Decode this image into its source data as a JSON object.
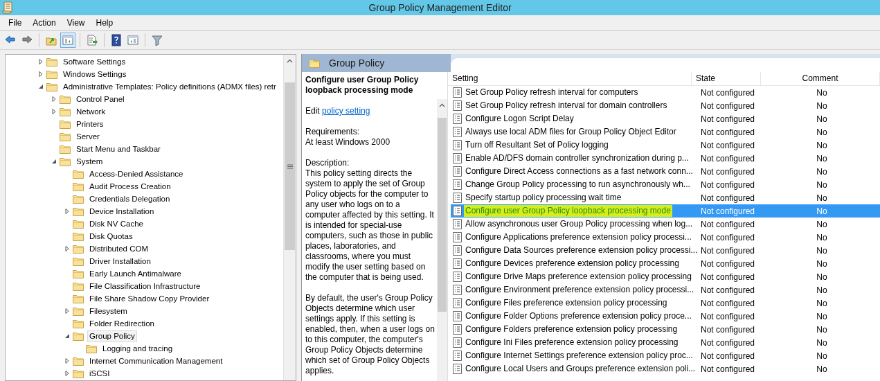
{
  "window": {
    "title": "Group Policy Management Editor"
  },
  "menu": [
    "File",
    "Action",
    "View",
    "Help"
  ],
  "toolbar": [
    {
      "pressed": false
    },
    {
      "pressed": false
    },
    {
      "pressed": false
    },
    {
      "pressed": true
    },
    {
      "pressed": false
    },
    {
      "pressed": false
    },
    {
      "pressed": false
    },
    {
      "pressed": false
    }
  ],
  "tree": [
    {
      "label": "Software Settings",
      "has_children": true,
      "expanded": false,
      "selected": false
    },
    {
      "label": "Windows Settings",
      "has_children": true,
      "expanded": false,
      "selected": false
    },
    {
      "label": "Administrative Templates: Policy definitions (ADMX files) retr",
      "has_children": true,
      "expanded": true,
      "selected": false,
      "children": [
        {
          "label": "Control Panel",
          "has_children": true,
          "expanded": false,
          "selected": false
        },
        {
          "label": "Network",
          "has_children": true,
          "expanded": false,
          "selected": false
        },
        {
          "label": "Printers",
          "has_children": false,
          "expanded": false,
          "selected": false
        },
        {
          "label": "Server",
          "has_children": false,
          "expanded": false,
          "selected": false
        },
        {
          "label": "Start Menu and Taskbar",
          "has_children": false,
          "expanded": false,
          "selected": false
        },
        {
          "label": "System",
          "has_children": true,
          "expanded": true,
          "selected": false,
          "children": [
            {
              "label": "Access-Denied Assistance",
              "has_children": false,
              "expanded": false,
              "selected": false
            },
            {
              "label": "Audit Process Creation",
              "has_children": false,
              "expanded": false,
              "selected": false
            },
            {
              "label": "Credentials Delegation",
              "has_children": false,
              "expanded": false,
              "selected": false
            },
            {
              "label": "Device Installation",
              "has_children": true,
              "expanded": false,
              "selected": false
            },
            {
              "label": "Disk NV Cache",
              "has_children": false,
              "expanded": false,
              "selected": false
            },
            {
              "label": "Disk Quotas",
              "has_children": false,
              "expanded": false,
              "selected": false
            },
            {
              "label": "Distributed COM",
              "has_children": true,
              "expanded": false,
              "selected": false
            },
            {
              "label": "Driver Installation",
              "has_children": false,
              "expanded": false,
              "selected": false
            },
            {
              "label": "Early Launch Antimalware",
              "has_children": false,
              "expanded": false,
              "selected": false
            },
            {
              "label": "File Classification Infrastructure",
              "has_children": false,
              "expanded": false,
              "selected": false
            },
            {
              "label": "File Share Shadow Copy Provider",
              "has_children": false,
              "expanded": false,
              "selected": false
            },
            {
              "label": "Filesystem",
              "has_children": true,
              "expanded": false,
              "selected": false
            },
            {
              "label": "Folder Redirection",
              "has_children": false,
              "expanded": false,
              "selected": false
            },
            {
              "label": "Group Policy",
              "has_children": true,
              "expanded": true,
              "selected": true,
              "children": [
                {
                  "label": "Logging and tracing",
                  "has_children": false,
                  "expanded": false,
                  "selected": false
                }
              ]
            },
            {
              "label": "Internet Communication Management",
              "has_children": true,
              "expanded": false,
              "selected": false
            },
            {
              "label": "iSCSI",
              "has_children": true,
              "expanded": false,
              "selected": false
            }
          ]
        }
      ]
    }
  ],
  "header": {
    "title": "Group Policy"
  },
  "description": {
    "title": "Configure user Group Policy loopback processing mode",
    "edit_prefix": "Edit",
    "edit_link": "policy setting",
    "requirements_label": "Requirements:",
    "requirements": "At least Windows 2000",
    "description_label": "Description:",
    "paragraphs": [
      "This policy setting directs the system to apply the set of Group Policy objects for the computer to any user who logs on to a computer affected by this setting. It is intended for special-use computers, such as those in public places, laboratories, and classrooms, where you must modify the user setting based on the computer that is being used.",
      "By default, the user's Group Policy Objects determine which user settings apply. If this setting is enabled, then, when a user logs on to this computer, the computer's Group Policy Objects determine which set of Group Policy Objects applies."
    ]
  },
  "table": {
    "columns": [
      "Setting",
      "State",
      "Comment"
    ],
    "rows": [
      {
        "setting": "Set Group Policy refresh interval for computers",
        "state": "Not configured",
        "comment": "No",
        "selected": false,
        "highlighted": false
      },
      {
        "setting": "Set Group Policy refresh interval for domain controllers",
        "state": "Not configured",
        "comment": "No",
        "selected": false,
        "highlighted": false
      },
      {
        "setting": "Configure Logon Script Delay",
        "state": "Not configured",
        "comment": "No",
        "selected": false,
        "highlighted": false
      },
      {
        "setting": "Always use local ADM files for Group Policy Object Editor",
        "state": "Not configured",
        "comment": "No",
        "selected": false,
        "highlighted": false
      },
      {
        "setting": "Turn off Resultant Set of Policy logging",
        "state": "Not configured",
        "comment": "No",
        "selected": false,
        "highlighted": false
      },
      {
        "setting": "Enable AD/DFS domain controller synchronization during p...",
        "state": "Not configured",
        "comment": "No",
        "selected": false,
        "highlighted": false
      },
      {
        "setting": "Configure Direct Access connections as a fast network conn...",
        "state": "Not configured",
        "comment": "No",
        "selected": false,
        "highlighted": false
      },
      {
        "setting": "Change Group Policy processing to run asynchronously wh...",
        "state": "Not configured",
        "comment": "No",
        "selected": false,
        "highlighted": false
      },
      {
        "setting": "Specify startup policy processing wait time",
        "state": "Not configured",
        "comment": "No",
        "selected": false,
        "highlighted": false
      },
      {
        "setting": "Configure user Group Policy loopback processing mode",
        "state": "Not configured",
        "comment": "No",
        "selected": true,
        "highlighted": true
      },
      {
        "setting": "Allow asynchronous user Group Policy processing when log...",
        "state": "Not configured",
        "comment": "No",
        "selected": false,
        "highlighted": false
      },
      {
        "setting": "Configure Applications preference extension policy processi...",
        "state": "Not configured",
        "comment": "No",
        "selected": false,
        "highlighted": false
      },
      {
        "setting": "Configure Data Sources preference extension policy processi...",
        "state": "Not configured",
        "comment": "No",
        "selected": false,
        "highlighted": false
      },
      {
        "setting": "Configure Devices preference extension policy processing",
        "state": "Not configured",
        "comment": "No",
        "selected": false,
        "highlighted": false
      },
      {
        "setting": "Configure Drive Maps preference extension policy processing",
        "state": "Not configured",
        "comment": "No",
        "selected": false,
        "highlighted": false
      },
      {
        "setting": "Configure Environment preference extension policy processi...",
        "state": "Not configured",
        "comment": "No",
        "selected": false,
        "highlighted": false
      },
      {
        "setting": "Configure Files preference extension policy processing",
        "state": "Not configured",
        "comment": "No",
        "selected": false,
        "highlighted": false
      },
      {
        "setting": "Configure Folder Options preference extension policy proce...",
        "state": "Not configured",
        "comment": "No",
        "selected": false,
        "highlighted": false
      },
      {
        "setting": "Configure Folders preference extension policy processing",
        "state": "Not configured",
        "comment": "No",
        "selected": false,
        "highlighted": false
      },
      {
        "setting": "Configure Ini Files preference extension policy processing",
        "state": "Not configured",
        "comment": "No",
        "selected": false,
        "highlighted": false
      },
      {
        "setting": "Configure Internet Settings preference extension policy proc...",
        "state": "Not configured",
        "comment": "No",
        "selected": false,
        "highlighted": false
      },
      {
        "setting": "Configure Local Users and Groups preference extension poli...",
        "state": "Not configured",
        "comment": "No",
        "selected": false,
        "highlighted": false
      }
    ]
  }
}
